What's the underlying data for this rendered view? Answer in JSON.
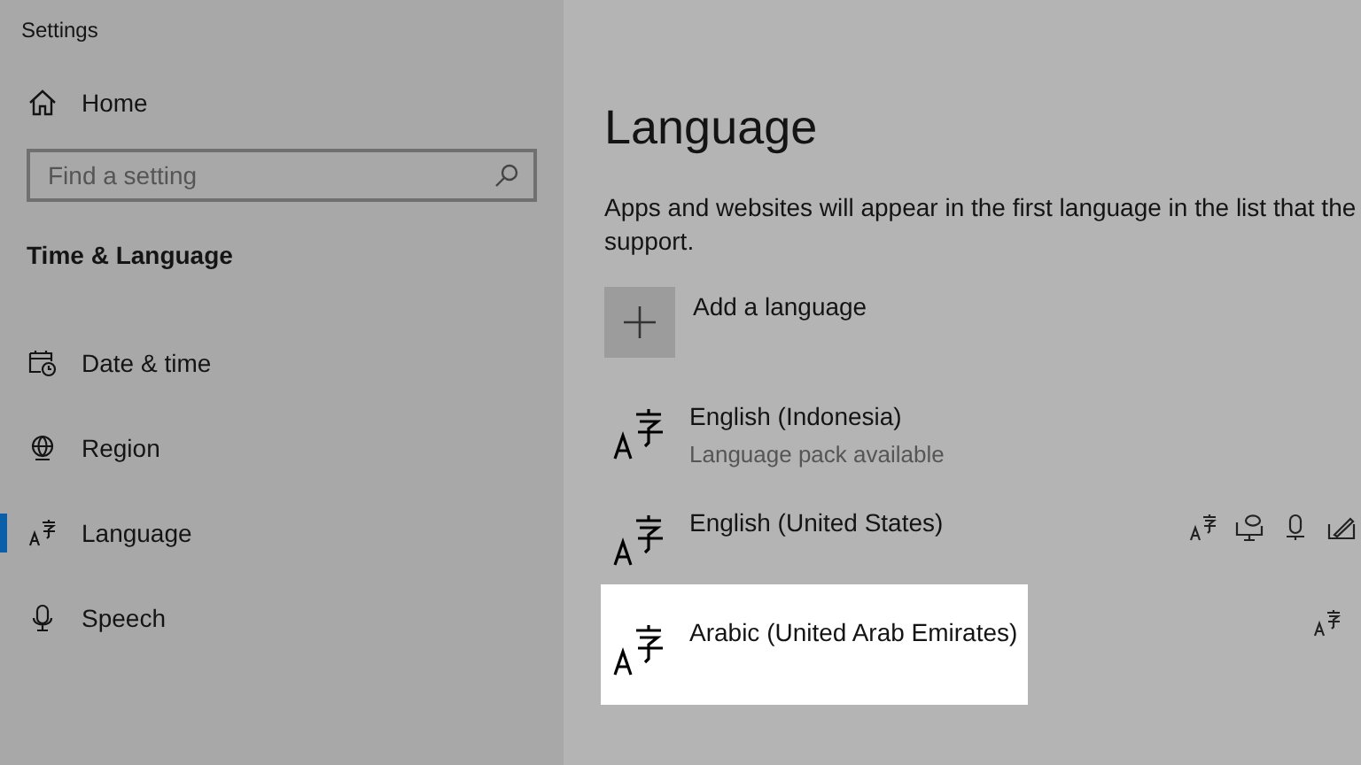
{
  "window": {
    "title": "Settings"
  },
  "sidebar": {
    "home": "Home",
    "search": {
      "placeholder": "Find a setting"
    },
    "section": "Time & Language",
    "items": [
      {
        "label": "Date & time",
        "kind": "calendar",
        "selected": false
      },
      {
        "label": "Region",
        "kind": "globe",
        "selected": false
      },
      {
        "label": "Language",
        "kind": "language",
        "selected": true
      },
      {
        "label": "Speech",
        "kind": "mic",
        "selected": false
      }
    ]
  },
  "main": {
    "title": "Language",
    "intro": "Apps and websites will appear in the first language in the list that the support.",
    "add": "Add a language",
    "languages": [
      {
        "name": "English (Indonesia)",
        "note": "Language pack available",
        "kind": "none",
        "highlighted": false
      },
      {
        "name": "English (United States)",
        "kind": "full",
        "highlighted": false
      },
      {
        "name": "Arabic (United Arab Emirates)",
        "kind": "basic",
        "highlighted": true
      }
    ]
  }
}
